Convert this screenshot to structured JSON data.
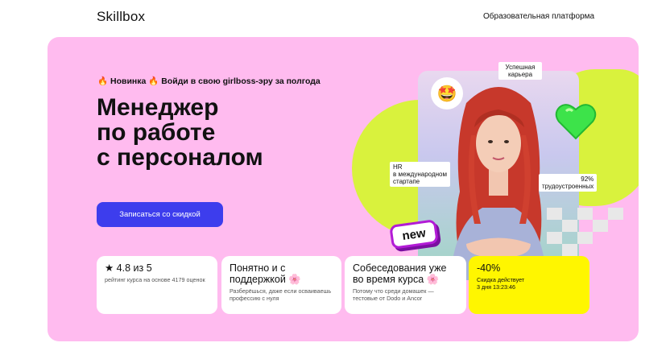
{
  "header": {
    "logo": "Skillbox",
    "platform_label": "Образовательная платформа"
  },
  "hero": {
    "tag_flame_icon": "🔥",
    "tag_new": "Новинка",
    "tag_text": "Войди в свою girlboss-эру за полгода",
    "title_lines": [
      "Менеджер",
      "по работе",
      "с персоналом"
    ],
    "cta_label": "Записаться со скидкой",
    "badges": {
      "career": "Успешная карьера",
      "hr_line1": "HR",
      "hr_line2": "в международном",
      "hr_line3": "стартапе",
      "hired_pct": "92%",
      "hired_text": "трудоустроенных",
      "new": "new"
    },
    "emoji": "🤩"
  },
  "cards": [
    {
      "title": "★ 4.8 из 5",
      "sub": "рейтинг курса на основе 4179 оценок"
    },
    {
      "title": "Понятно и с поддержкой",
      "icon": "🌸",
      "sub": "Разберёшься, даже если осваиваешь профессию с нуля"
    },
    {
      "title": "Собеседования уже во время курса",
      "icon": "🌸",
      "sub": "Потому что среди домашек — тестовые от Dodo и Ancor"
    },
    {
      "title": "-40%",
      "sub_line1": "Скидка действует",
      "sub_line2": "3 дня 13:23:46"
    }
  ],
  "colors": {
    "hero_bg": "#ffbbef",
    "cta_bg": "#3d3ded",
    "accent_green": "#d9f23d",
    "discount_bg": "#fff600",
    "new_border": "#b21bd6"
  }
}
